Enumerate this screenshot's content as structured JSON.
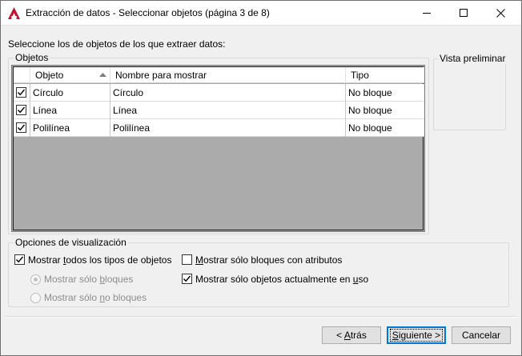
{
  "window": {
    "title": "Extracción de datos - Seleccionar objetos (página 3 de 8)",
    "controls": {
      "minimize": "minimize-icon",
      "maximize": "maximize-icon",
      "close": "close-icon"
    }
  },
  "instructions": "Seleccione los de objetos de los que extraer datos:",
  "objects_group": {
    "label": "Objetos",
    "columns": [
      "Objeto",
      "Nombre para mostrar",
      "Tipo"
    ],
    "sort_icon": "sort-ascending-icon",
    "rows": [
      {
        "checked": true,
        "object": "Círculo",
        "display_name": "Círculo",
        "type": "No bloque"
      },
      {
        "checked": true,
        "object": "Línea",
        "display_name": "Línea",
        "type": "No bloque"
      },
      {
        "checked": true,
        "object": "Polilínea",
        "display_name": "Polilínea",
        "type": "No bloque"
      }
    ]
  },
  "preview_group": {
    "label": "Vista preliminar"
  },
  "display_options": {
    "label": "Opciones de visualización",
    "show_all_types": {
      "pre": "Mostrar ",
      "u": "t",
      "post": "odos los tipos de objetos",
      "checked": true
    },
    "only_blocks": {
      "pre": "Mostrar sólo ",
      "u": "b",
      "post": "loques",
      "selected": true,
      "enabled": false
    },
    "only_non_blocks": {
      "pre": "Mostrar sólo ",
      "u": "n",
      "post": "o bloques",
      "selected": false,
      "enabled": false
    },
    "blocks_with_attributes": {
      "pre": "",
      "u": "M",
      "post": "ostrar sólo bloques con atributos",
      "checked": false
    },
    "objects_in_use": {
      "pre": "Mostrar sólo objetos actualmente en ",
      "u": "u",
      "post": "so",
      "checked": true
    }
  },
  "buttons": {
    "back": {
      "pre": "< ",
      "u": "A",
      "post": "trás"
    },
    "next": {
      "pre": "",
      "u": "S",
      "post": "iguiente >"
    },
    "cancel": {
      "label": "Cancelar"
    }
  },
  "colors": {
    "accent": "#0078d7",
    "grid_empty": "#ababab",
    "autocad_red": "#c8102e"
  }
}
